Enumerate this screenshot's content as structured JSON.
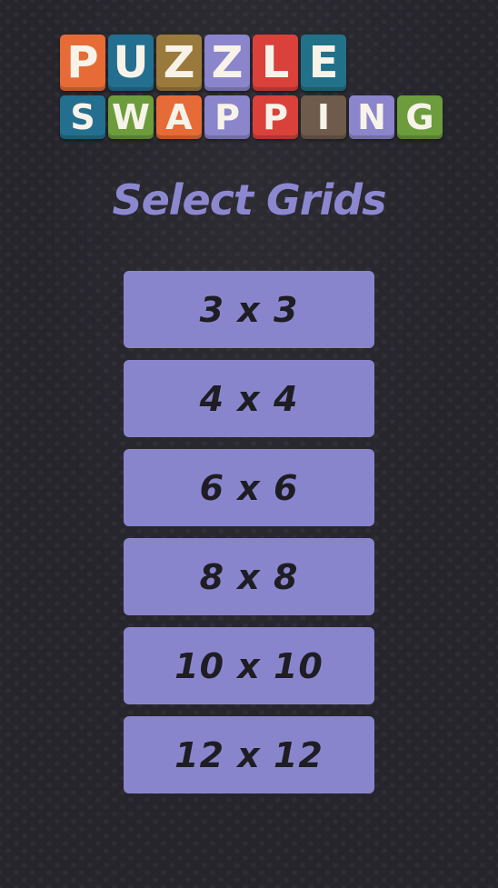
{
  "logo": {
    "row1": [
      {
        "letter": "P",
        "color": "#e66b36"
      },
      {
        "letter": "U",
        "color": "#246f8f"
      },
      {
        "letter": "Z",
        "color": "#9a7a3c"
      },
      {
        "letter": "Z",
        "color": "#8b85cc"
      },
      {
        "letter": "L",
        "color": "#d9413a"
      },
      {
        "letter": "E",
        "color": "#237189"
      }
    ],
    "row2": [
      {
        "letter": "S",
        "color": "#246f8f"
      },
      {
        "letter": "W",
        "color": "#6c9c3c"
      },
      {
        "letter": "A",
        "color": "#e66b36"
      },
      {
        "letter": "P",
        "color": "#8b85cc"
      },
      {
        "letter": "P",
        "color": "#d9413a"
      },
      {
        "letter": "I",
        "color": "#6f5b4b"
      },
      {
        "letter": "N",
        "color": "#8b85cc"
      },
      {
        "letter": "G",
        "color": "#6c9c3c"
      }
    ]
  },
  "title": "Select Grids",
  "buttons": [
    {
      "label": "3 x 3"
    },
    {
      "label": "4 x 4"
    },
    {
      "label": "6 x 6"
    },
    {
      "label": "8 x 8"
    },
    {
      "label": "10 x 10"
    },
    {
      "label": "12 x 12"
    }
  ],
  "colors": {
    "background": "#26252c",
    "accent": "#8985cd",
    "button_text": "#1e1d23"
  }
}
